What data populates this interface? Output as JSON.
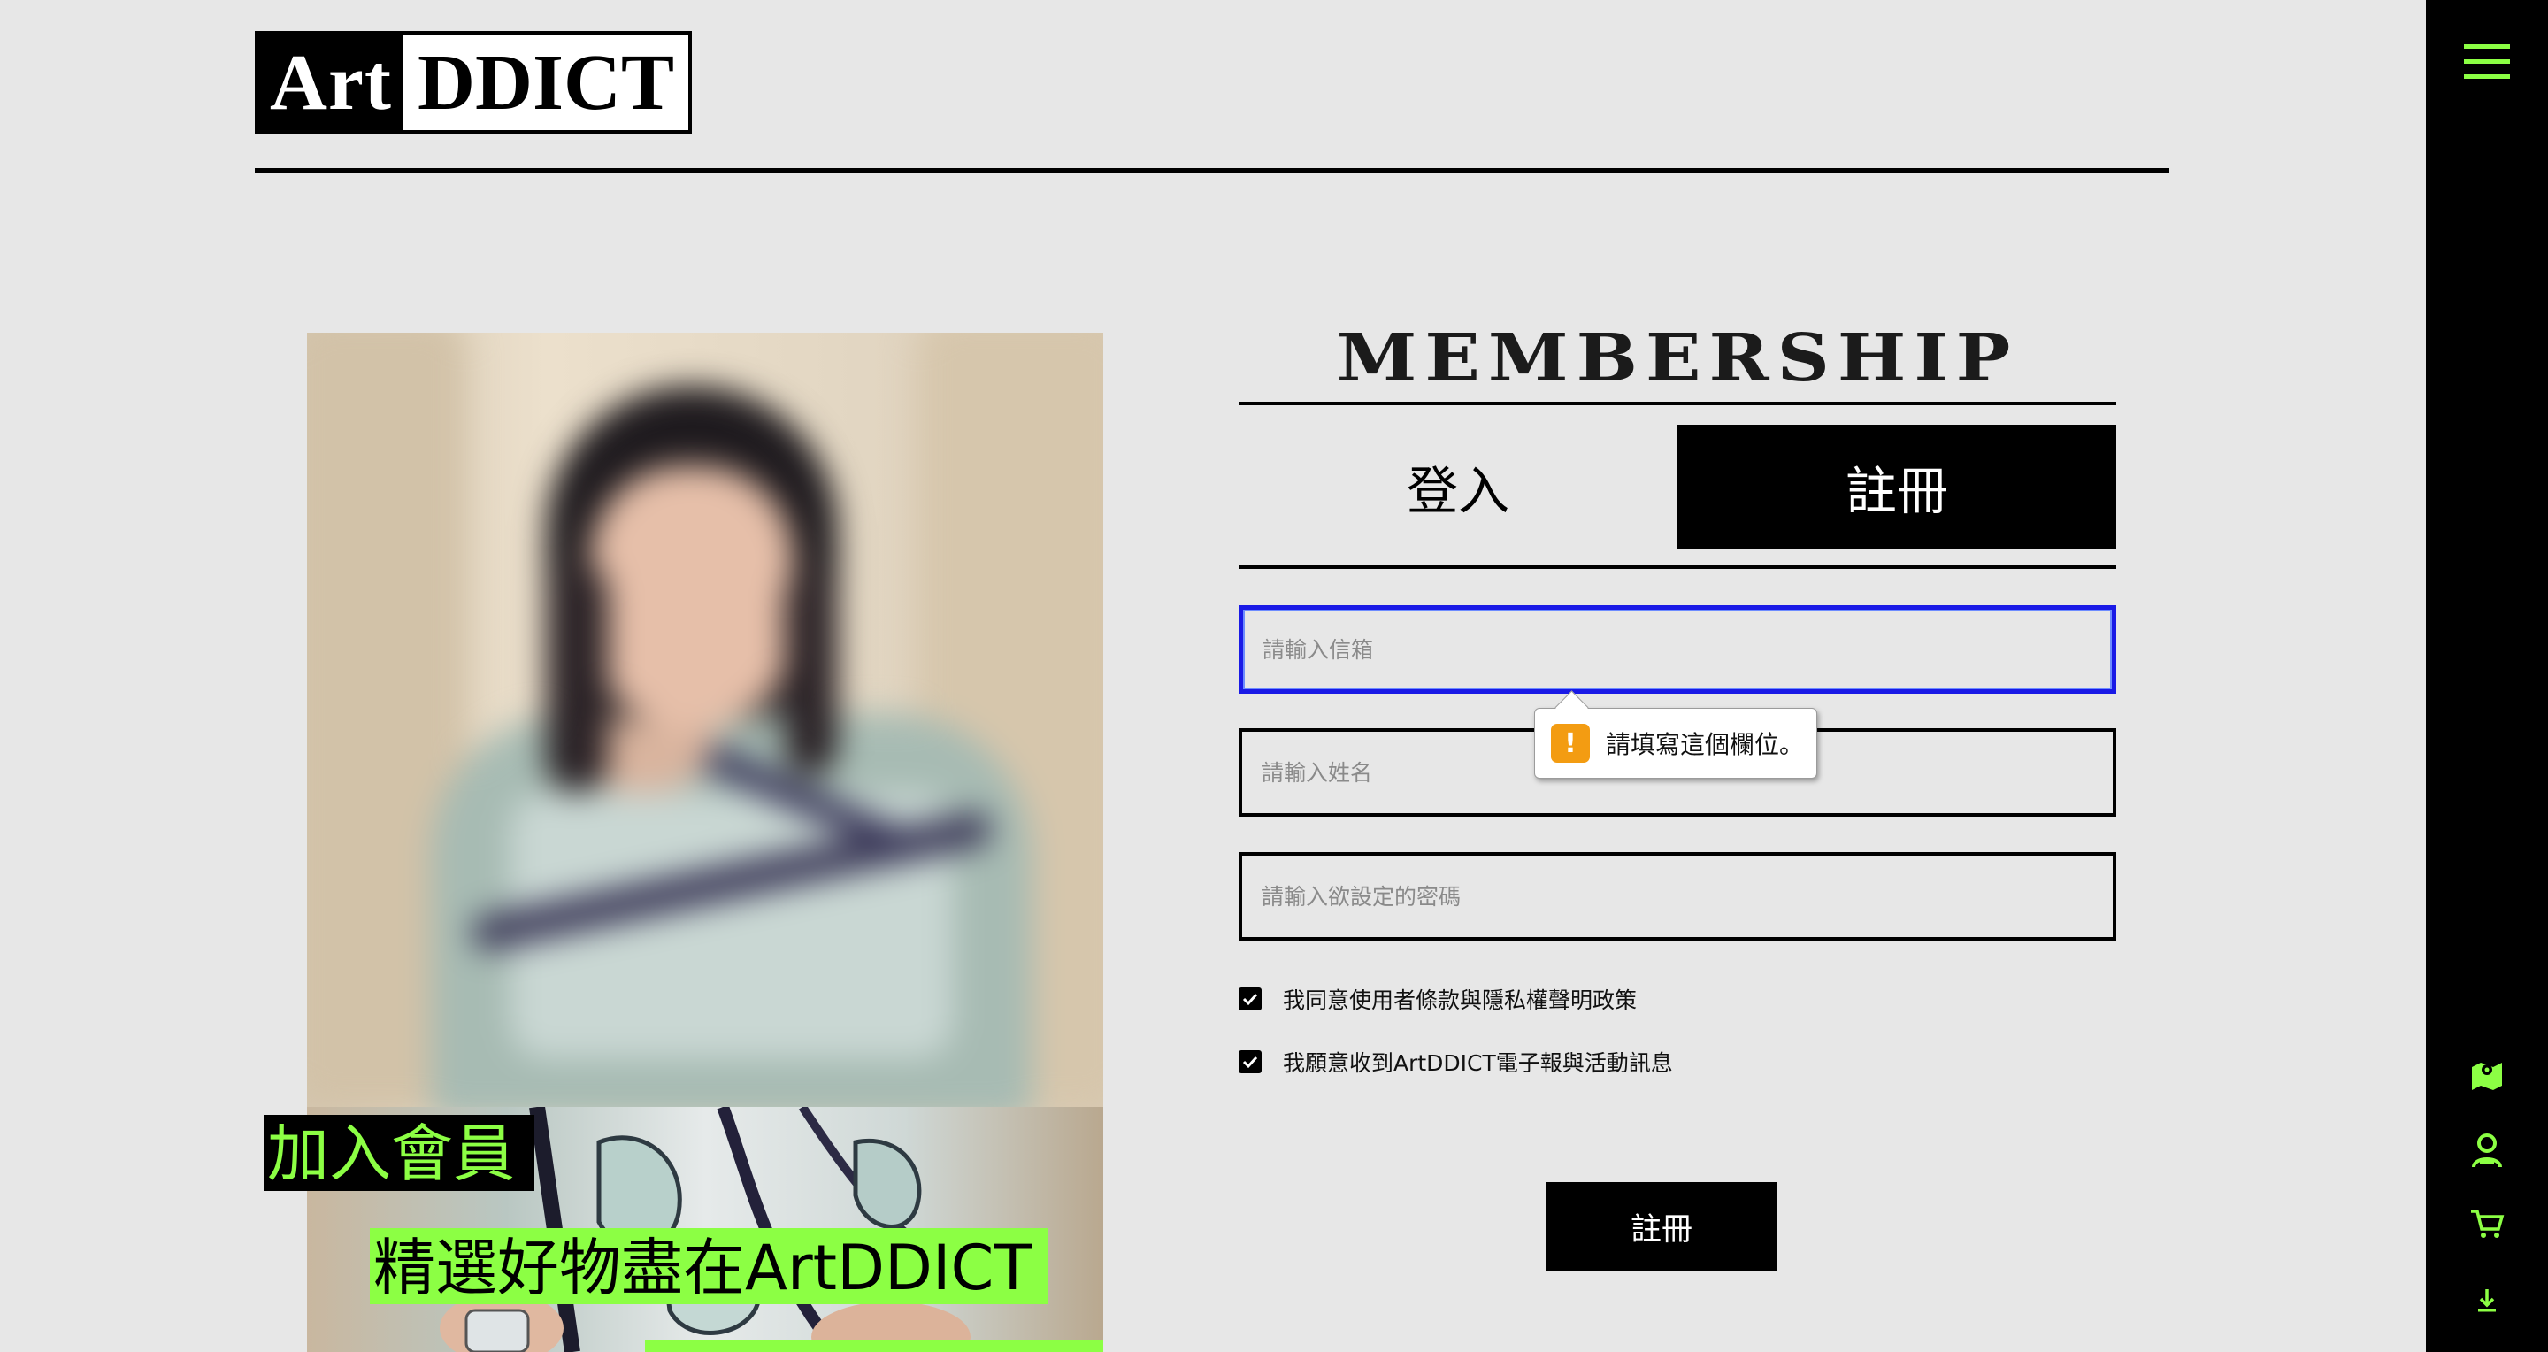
{
  "logo": {
    "part1": "Art",
    "part2": "DDICT"
  },
  "hero": {
    "title": "加入會員",
    "subtitle": "精選好物盡在ArtDDICT"
  },
  "form": {
    "title": "MEMBERSHIP",
    "tabs": [
      {
        "label": "登入",
        "active": false
      },
      {
        "label": "註冊",
        "active": true
      }
    ],
    "email_placeholder": "請輸入信箱",
    "name_placeholder": "請輸入姓名",
    "password_placeholder": "請輸入欲設定的密碼",
    "validation_message": "請填寫這個欄位。",
    "terms_label": "我同意使用者條款與隱私權聲明政策",
    "terms_checked": true,
    "newsletter_label": "我願意收到ArtDDICT電子報與活動訊息",
    "newsletter_checked": true,
    "submit_label": "註冊"
  },
  "sidebar": {
    "icons": [
      "menu-icon",
      "map-icon",
      "user-icon",
      "cart-icon",
      "download-icon"
    ]
  },
  "colors": {
    "accent_green": "#8cff44",
    "focus_blue": "#1a1ae6",
    "warning_orange": "#f39c12",
    "background": "#e7e7e7"
  }
}
